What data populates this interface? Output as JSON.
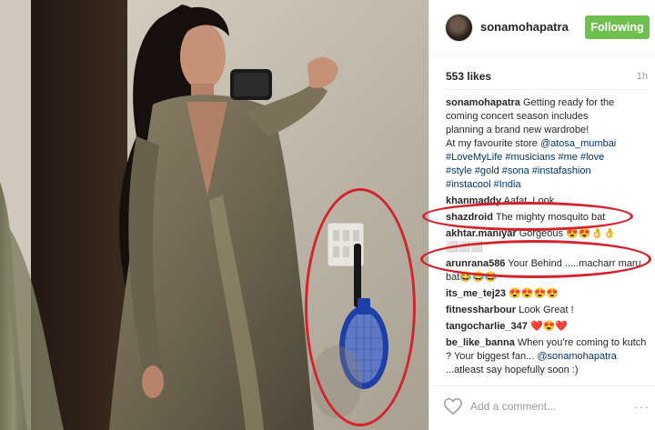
{
  "post": {
    "username": "sonamohapatra",
    "follow_label": "Following",
    "likes": "553 likes",
    "time": "1h"
  },
  "caption": {
    "user": "sonamohapatra",
    "lines": [
      "Getting ready for the",
      "coming concert season includes",
      "planning a brand new wardrobe!",
      "At my favourite store",
      "#LoveMyLife #musicians #me #love",
      "#style #gold #sona #instafashion",
      "#instacool #India"
    ],
    "store_tag": "@atosa_mumbai"
  },
  "comments": [
    {
      "user": "khanmaddy",
      "text": "Aafat. Look"
    },
    {
      "user": "shazdroid",
      "text": "The mighty mosquito bat"
    },
    {
      "user": "akhtar.maniyar",
      "text": "Gorgeous 😍😍👌👌⬜⬜⬜"
    },
    {
      "user": "arunrana586",
      "text": "Your Behind .....macharr maru bat😂😂😂"
    },
    {
      "user": "its_me_tej23",
      "text": "😍😍😍😍"
    },
    {
      "user": "fitnessharbour",
      "text": "Look Great !"
    },
    {
      "user": "tangocharlie_347",
      "text": "❤️😍❤️"
    },
    {
      "user": "be_like_banna",
      "text": "When you're coming to kutch ? Your biggest fan...",
      "mention": "@sonamohapatra",
      "text2": "...atleast say hopefully soon :)"
    }
  ],
  "add_comment": {
    "placeholder": "Add a comment...",
    "more": "···"
  },
  "icons": {
    "heart": "heart-icon",
    "avatar": "avatar",
    "more": "more-options-icon"
  },
  "colors": {
    "follow_green": "#70c050",
    "link_blue": "#003569",
    "annotation_red": "#d4232b"
  }
}
